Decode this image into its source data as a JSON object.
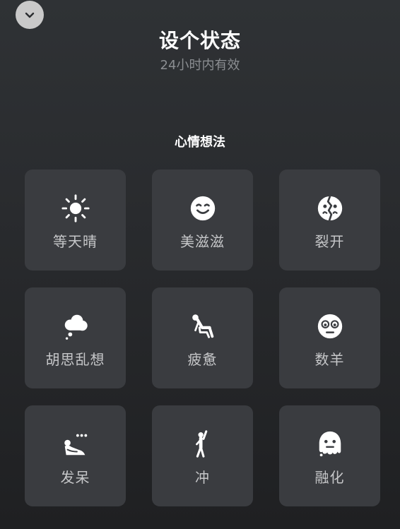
{
  "header": {
    "title": "设个状态",
    "subtitle": "24小时内有效"
  },
  "section": {
    "title": "心情想法"
  },
  "statuses": [
    {
      "label": "等天晴",
      "icon": "sun-icon"
    },
    {
      "label": "美滋滋",
      "icon": "smile-face-icon"
    },
    {
      "label": "裂开",
      "icon": "cracked-face-icon"
    },
    {
      "label": "胡思乱想",
      "icon": "thought-cloud-icon"
    },
    {
      "label": "疲惫",
      "icon": "slumped-person-icon"
    },
    {
      "label": "数羊",
      "icon": "sleepy-eyes-face-icon"
    },
    {
      "label": "发呆",
      "icon": "daydreaming-person-icon"
    },
    {
      "label": "冲",
      "icon": "cheering-person-icon"
    },
    {
      "label": "融化",
      "icon": "melting-face-icon"
    }
  ],
  "colors": {
    "background_top": "#2f3235",
    "background_bottom": "#1f2022",
    "tile": "#3a3c40",
    "label": "#c6c7c9",
    "subtitle": "#8b8e92",
    "collapse_button": "#c9c9c9"
  }
}
